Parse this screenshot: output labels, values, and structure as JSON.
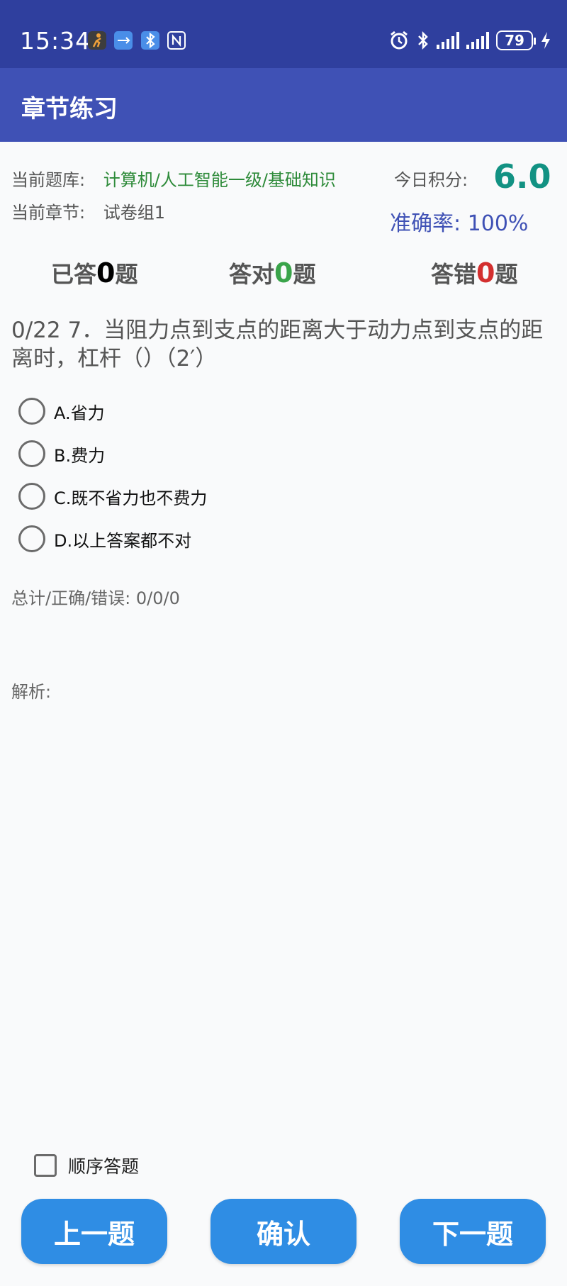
{
  "status_bar": {
    "time": "15:34",
    "battery": "79"
  },
  "app_bar": {
    "title": "章节练习"
  },
  "info": {
    "library_label": "当前题库:",
    "library_value": "计算机/人工智能一级/基础知识",
    "chapter_label": "当前章节:",
    "chapter_value": "试卷组1",
    "score_label": "今日积分:",
    "score_value": "6.0",
    "accuracy": "准确率: 100%"
  },
  "stats": {
    "answered_prefix": "已答",
    "answered_count": "0",
    "correct_prefix": "答对",
    "correct_count": "0",
    "wrong_prefix": "答错",
    "wrong_count": "0",
    "suffix": "题"
  },
  "question": {
    "text": "0/22 7．当阻力点到支点的距离大于动力点到支点的距离时，杠杆（）（2′）"
  },
  "options": [
    {
      "label": "A.省力"
    },
    {
      "label": "B.费力"
    },
    {
      "label": "C.既不省力也不费力"
    },
    {
      "label": "D.以上答案都不对"
    }
  ],
  "summary": "总计/正确/错误: 0/0/0",
  "analysis": "解析:",
  "order_checkbox": {
    "label": "顺序答题"
  },
  "buttons": {
    "prev": "上一题",
    "confirm": "确认",
    "next": "下一题"
  },
  "colors": {
    "status_bar": "#2f3f9e",
    "app_bar": "#3f51b5",
    "button": "#2f8de4",
    "library": "#2e8b3a",
    "score": "#129283"
  }
}
